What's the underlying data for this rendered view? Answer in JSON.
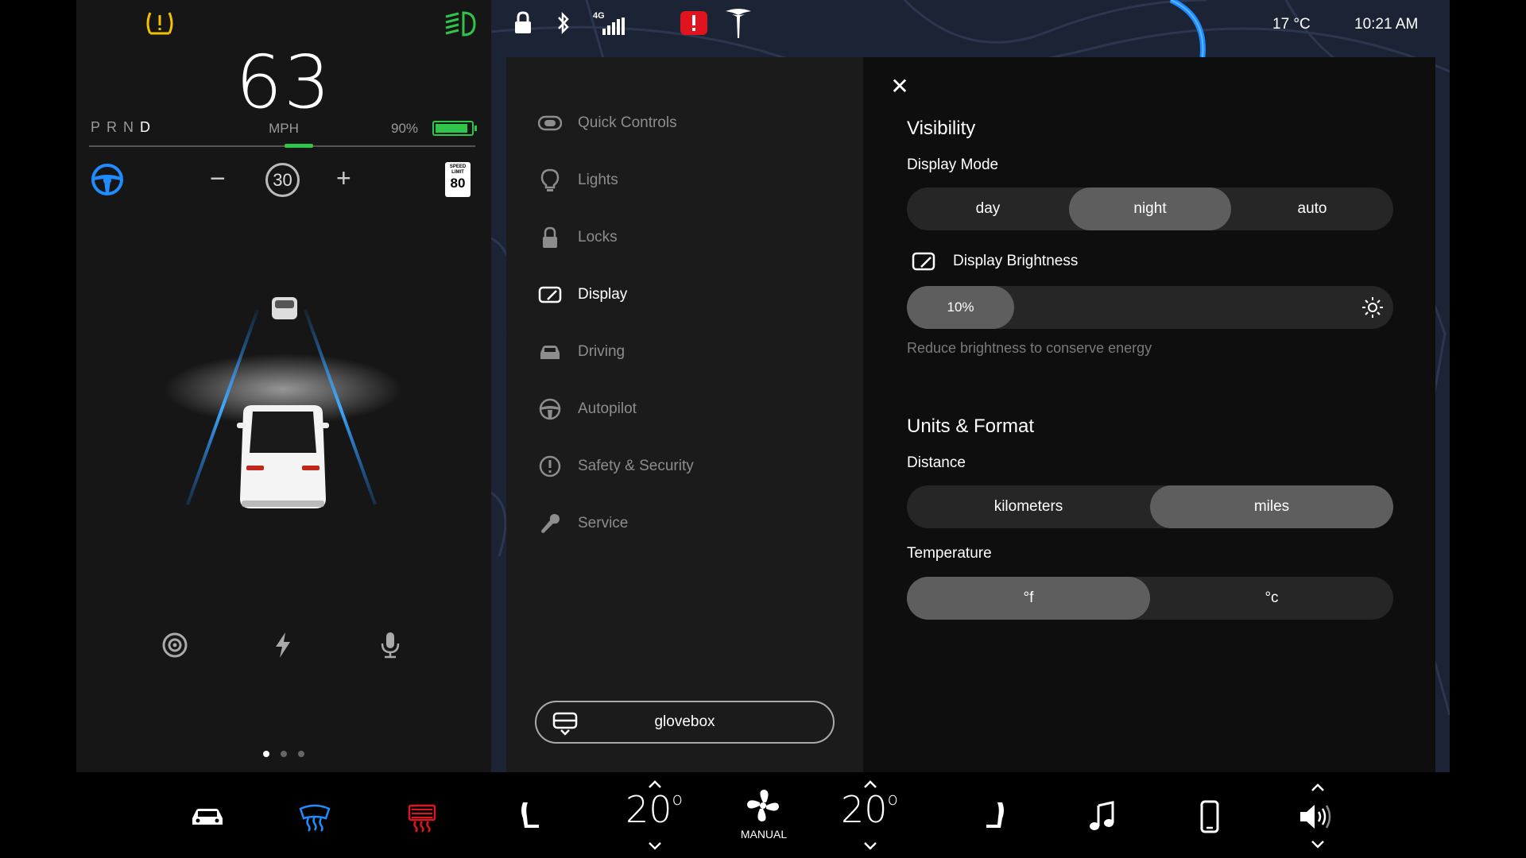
{
  "status": {
    "speed": "63",
    "speed_unit": "MPH",
    "gears": [
      "P",
      "R",
      "N",
      "D"
    ],
    "active_gear": "D",
    "battery_percent": "90%",
    "battery_level": 0.9,
    "set_speed": "30",
    "speed_limit_label": "SPEED LIMIT",
    "speed_limit": "80",
    "network": "4G",
    "outside_temp": "17 °C",
    "time": "10:21 AM"
  },
  "colors": {
    "accent_green": "#2fc54b",
    "accent_blue": "#1f8cff",
    "warning_yellow": "#f2c200",
    "alert_red": "#e0141e"
  },
  "menu": {
    "items": [
      {
        "label": "Quick Controls",
        "icon": "toggle-icon"
      },
      {
        "label": "Lights",
        "icon": "bulb-icon"
      },
      {
        "label": "Locks",
        "icon": "lock-icon"
      },
      {
        "label": "Display",
        "icon": "display-icon",
        "active": true
      },
      {
        "label": "Driving",
        "icon": "car-icon"
      },
      {
        "label": "Autopilot",
        "icon": "steering-wheel-icon"
      },
      {
        "label": "Safety & Security",
        "icon": "alert-circle-icon"
      },
      {
        "label": "Service",
        "icon": "wrench-icon"
      }
    ],
    "glovebox_label": "glovebox"
  },
  "detail": {
    "visibility_title": "Visibility",
    "display_mode_label": "Display Mode",
    "display_modes": [
      "day",
      "night",
      "auto"
    ],
    "display_mode_selected": "night",
    "brightness_label": "Display Brightness",
    "brightness_value": "10%",
    "brightness_level": 0.1,
    "brightness_hint": "Reduce brightness to conserve energy",
    "units_title": "Units & Format",
    "distance_label": "Distance",
    "distance_options": [
      "kilometers",
      "miles"
    ],
    "distance_selected": "miles",
    "temperature_label": "Temperature",
    "temperature_options": [
      "°f",
      "°c"
    ],
    "temperature_selected": "°f"
  },
  "climate": {
    "driver_temp": "20",
    "passenger_temp": "20",
    "fan_mode": "MANUAL"
  }
}
